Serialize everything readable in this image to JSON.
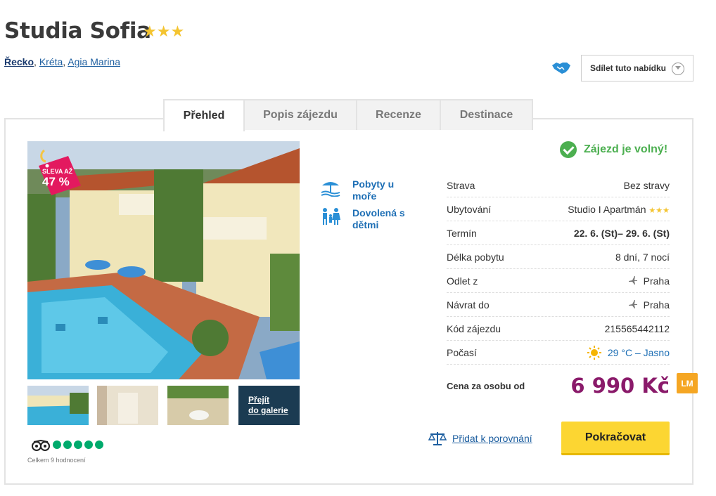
{
  "hotel": {
    "name": "Studia Sofia",
    "stars": "★★★",
    "breadcrumb": [
      "Řecko",
      "Kréta",
      "Agia Marina"
    ]
  },
  "share": {
    "label": "Sdílet tuto nabídku"
  },
  "tabs": [
    {
      "label": "Přehled",
      "active": true
    },
    {
      "label": "Popis zájezdu",
      "active": false
    },
    {
      "label": "Recenze",
      "active": false
    },
    {
      "label": "Destinace",
      "active": false
    }
  ],
  "sale": {
    "line1": "SLEVA AŽ",
    "line2": "47 %"
  },
  "gallery": {
    "link_label_1": "Přejít",
    "link_label_2": "do galerie"
  },
  "tripadvisor": {
    "rating_dots": 5,
    "count_text": "Celkem 9 hodnocení"
  },
  "features": [
    {
      "label": "Pobyty u moře",
      "icon": "beach-umbrella-icon"
    },
    {
      "label": "Dovolená s dětmi",
      "icon": "family-icon"
    }
  ],
  "status": {
    "text": "Zájezd je volný!"
  },
  "info": {
    "strava": {
      "label": "Strava",
      "value": "Bez stravy"
    },
    "ubytovani": {
      "label": "Ubytování",
      "value": "Studio I Apartmán",
      "stars": "★★★"
    },
    "termin": {
      "label": "Termín",
      "value": "22. 6. (St)– 29. 6. (St)"
    },
    "delka": {
      "label": "Délka pobytu",
      "value": "8 dní, 7 nocí"
    },
    "odlet": {
      "label": "Odlet z",
      "value": "Praha"
    },
    "navrat": {
      "label": "Návrat do",
      "value": "Praha"
    },
    "kod": {
      "label": "Kód zájezdu",
      "value": "215565442112"
    },
    "pocasi": {
      "label": "Počasí",
      "value": "29 °C – Jasno"
    }
  },
  "price": {
    "label": "Cena za osobu od",
    "value": "6 990 Kč",
    "badge": "LM"
  },
  "actions": {
    "compare": "Přidat k porovnání",
    "continue": "Pokračovat"
  },
  "colors": {
    "price": "#8a1a6a",
    "accent": "#fcd632",
    "status": "#4caf50",
    "link": "#1e5fa0"
  }
}
